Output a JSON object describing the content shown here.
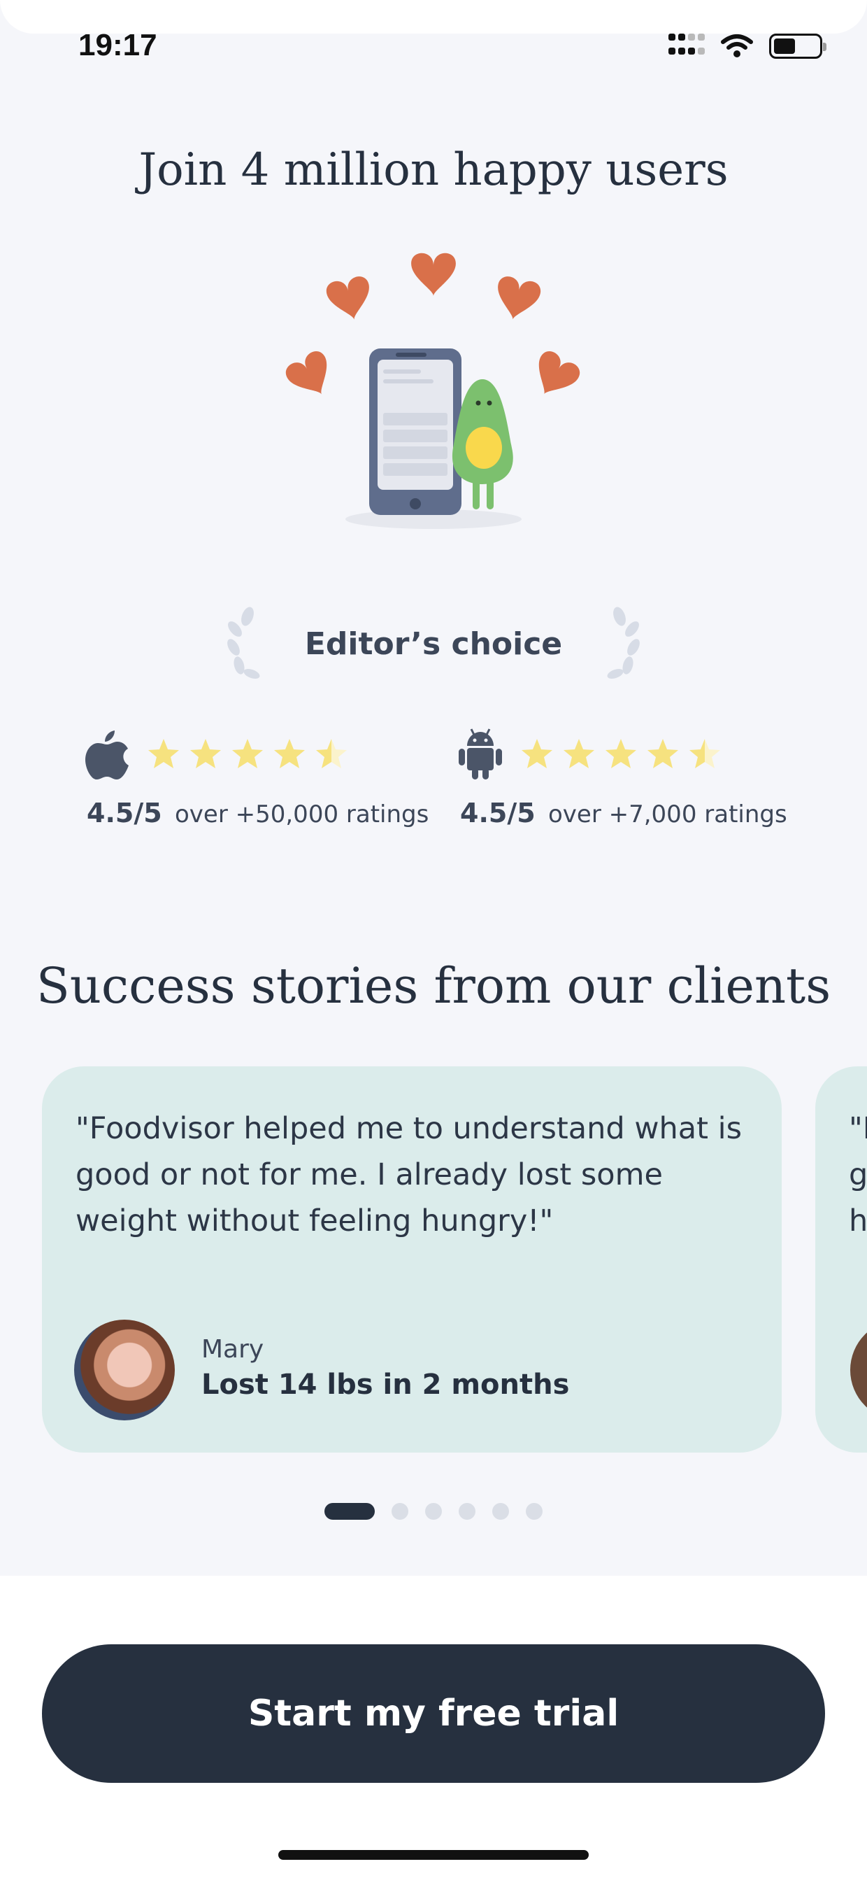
{
  "status_bar": {
    "time": "19:17"
  },
  "header": {
    "title": "Join 4 million happy users"
  },
  "editors_choice": {
    "label": "Editor’s choice"
  },
  "ratings": [
    {
      "platform": "apple-icon",
      "score": "4.5/5",
      "stars": 4.5,
      "count_text": "over +50,000 ratings"
    },
    {
      "platform": "android-icon",
      "score": "4.5/5",
      "stars": 4.5,
      "count_text": "over +7,000 ratings"
    }
  ],
  "stories": {
    "title": "Success stories from our clients",
    "items": [
      {
        "quote": "\"Foodvisor helped me to understand what is good or not for me. I already lost some weight without feeling hungry!\"",
        "name": "Mary",
        "result": "Lost 14 lbs in 2 months"
      },
      {
        "quote": "\"I g h",
        "name": "",
        "result": ""
      }
    ],
    "pagination": {
      "count": 6,
      "active_index": 0
    }
  },
  "cta": {
    "label": "Start my free trial"
  },
  "colors": {
    "background": "#f5f6fa",
    "primary": "#26303f",
    "card": "#dbeceb",
    "heart": "#d9704a",
    "star": "#f6e27f",
    "avocado": "#7cc06e"
  }
}
